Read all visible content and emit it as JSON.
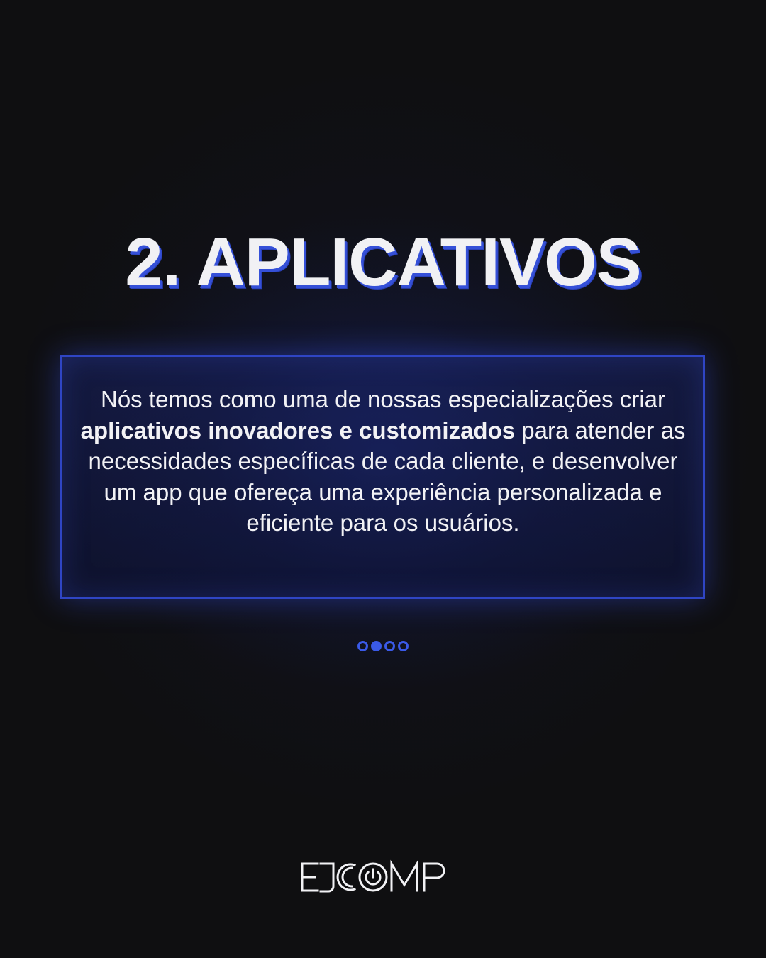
{
  "title": "2. APLICATIVOS",
  "body": {
    "part1": "Nós temos como uma de nossas especializações criar ",
    "bold": "aplicativos inovadores e customizados",
    "part2": " para atender as necessidades específicas de cada cliente, e desenvolver um app que ofereça uma experiência personalizada e eficiente para os usuários."
  },
  "pagination": {
    "total": 4,
    "active_index": 1
  },
  "logo": {
    "text": "EJCOMP"
  },
  "colors": {
    "background": "#0f0f11",
    "accent": "#3a5ae8",
    "text": "#f2f2f5"
  }
}
